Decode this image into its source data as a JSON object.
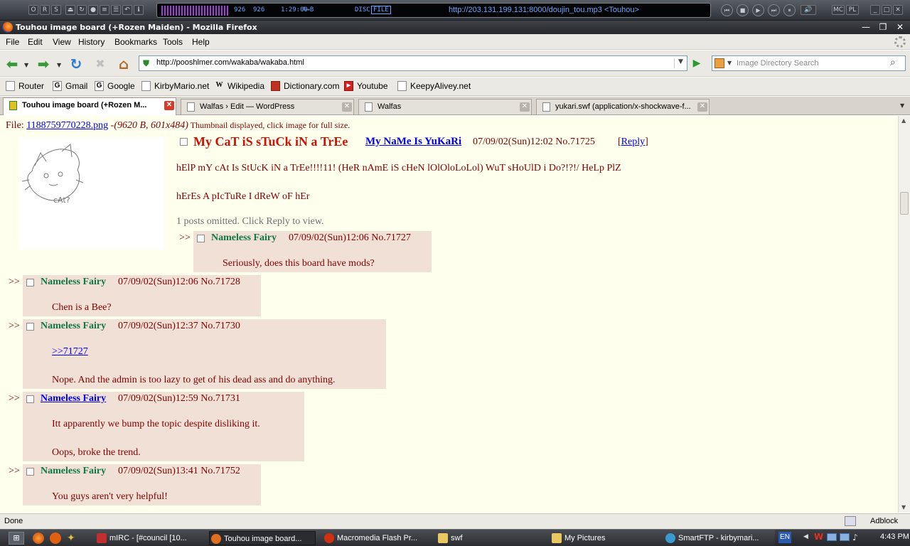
{
  "winamp": {
    "kbps": "926",
    "khz": "926",
    "time": "1:29:00",
    "ab_label": "A↔B",
    "disc_label": "DISC",
    "file_label": "FILE",
    "title": "http://203.131.199.131:8000/doujin_tou.mp3   <Touhou>",
    "buttons": [
      "MC",
      "PL"
    ]
  },
  "window": {
    "title": "Touhou image board (+Rozen Maiden) - Mozilla Firefox"
  },
  "menu": [
    "File",
    "Edit",
    "View",
    "History",
    "Bookmarks",
    "Tools",
    "Help"
  ],
  "nav": {
    "url": "http://pooshlmer.com/wakaba/wakaba.html",
    "search_placeholder": "Image Directory Search"
  },
  "bookmarks": [
    {
      "label": "Router",
      "icon": "page-icon"
    },
    {
      "label": "Gmail",
      "icon": "google-icon"
    },
    {
      "label": "Google",
      "icon": "google-icon"
    },
    {
      "label": "KirbyMario.net",
      "icon": "page-icon"
    },
    {
      "label": "Wikipedia",
      "icon": "wikipedia-icon"
    },
    {
      "label": "Dictionary.com",
      "icon": "dictionary-icon"
    },
    {
      "label": "Youtube",
      "icon": "youtube-icon"
    },
    {
      "label": "KeepyAlivey.net",
      "icon": "page-icon"
    }
  ],
  "tabs": [
    {
      "label": "Touhou image board (+Rozen M..."
    },
    {
      "label": "Walfas › Edit — WordPress"
    },
    {
      "label": "Walfas"
    },
    {
      "label": "yukari.swf (application/x-shockwave-f..."
    }
  ],
  "page": {
    "file_label": "File: ",
    "file_name": "1188759770228.png",
    "file_info": " -(9620 B, 601x484)",
    "thumb_note": " Thumbnail displayed, click image for full size.",
    "thumb_text": "cAt?",
    "op": {
      "subject": "My CaT iS sTuCk iN a TrEe",
      "name": "My NaMe Is YuKaRi",
      "date": "07/09/02(Sun)12:02",
      "number": "No.71725",
      "reply_link": "Reply",
      "reply_open": "[",
      "reply_close": "]",
      "line1": "hElP mY cAt Is StUcK iN a TrEe!!!!11! (HeR nAmE iS cHeN lOlOloLoLol) WuT sHoUlD i Do?!?!/ HeLp PlZ",
      "line2": "hErEs A pIcTuRe I dReW oF hEr"
    },
    "omitted": "1 posts omitted. Click Reply to view.",
    "replies": [
      {
        "arrow": ">>",
        "name": "Nameless Fairy",
        "meta": "07/09/02(Sun)12:06 No.71727",
        "text": "Seriously, does this board have mods?"
      },
      {
        "arrow": ">>",
        "name": "Nameless Fairy",
        "meta": "07/09/02(Sun)12:06 No.71728",
        "text": "Chen is a Bee?"
      },
      {
        "arrow": ">>",
        "name": "Nameless Fairy",
        "meta": "07/09/02(Sun)12:37 No.71730",
        "quote": ">>71727",
        "text": "Nope. And the admin is too lazy to get of his dead ass and do anything."
      },
      {
        "arrow": ">>",
        "name": "Nameless Fairy",
        "meta": "07/09/02(Sun)12:59 No.71731",
        "text": "Itt apparently we bump the topic despite disliking it.",
        "text2": "Oops, broke the trend."
      },
      {
        "arrow": ">>",
        "name": "Nameless Fairy",
        "meta": "07/09/02(Sun)13:41 No.71752",
        "text": "You guys aren't very helpful!"
      }
    ]
  },
  "status": {
    "text": "Done",
    "adblock": "Adblock"
  },
  "taskbar": {
    "tasks": [
      {
        "label": "mIRC - [#council [10..."
      },
      {
        "label": "Touhou image board..."
      },
      {
        "label": "Macromedia Flash Pr..."
      },
      {
        "label": "swf"
      },
      {
        "label": "My Pictures"
      },
      {
        "label": "SmartFTP - kirbymari..."
      }
    ],
    "lang": "EN",
    "clock": "4:43 PM"
  }
}
